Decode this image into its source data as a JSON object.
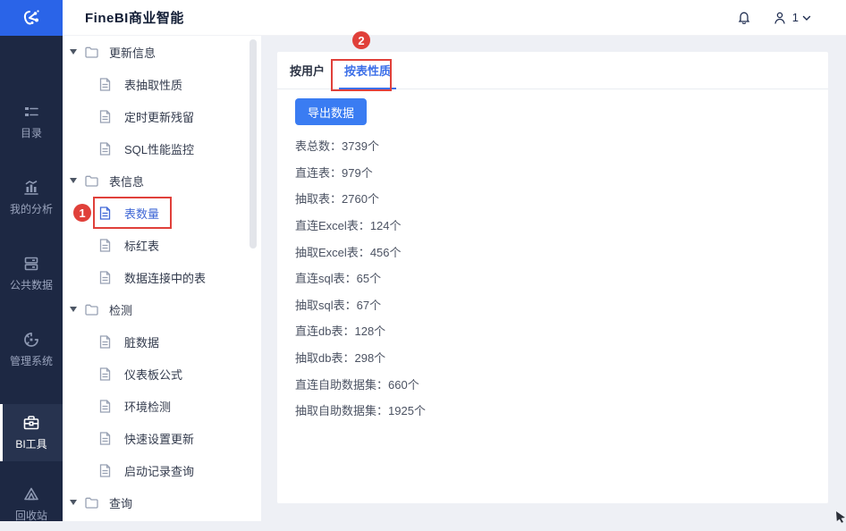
{
  "header": {
    "title": "FineBI商业智能",
    "account_count": "1"
  },
  "sidebar": {
    "items": [
      {
        "label": "目录",
        "icon": "catalog-icon",
        "active": false
      },
      {
        "label": "我的分析",
        "icon": "my-analysis-icon",
        "active": false
      },
      {
        "label": "公共数据",
        "icon": "public-data-icon",
        "active": false
      },
      {
        "label": "管理系统",
        "icon": "admin-system-icon",
        "active": false
      },
      {
        "label": "BI工具",
        "icon": "bi-tools-icon",
        "active": true
      },
      {
        "label": "回收站",
        "icon": "recycle-bin-icon",
        "active": false
      }
    ]
  },
  "tree": {
    "items": [
      {
        "type": "folder",
        "label": "更新信息",
        "expanded": true
      },
      {
        "type": "doc",
        "label": "表抽取性质"
      },
      {
        "type": "doc",
        "label": "定时更新残留"
      },
      {
        "type": "doc",
        "label": "SQL性能监控"
      },
      {
        "type": "folder",
        "label": "表信息",
        "expanded": true
      },
      {
        "type": "doc",
        "label": "表数量",
        "selected": true
      },
      {
        "type": "doc",
        "label": "标红表"
      },
      {
        "type": "doc",
        "label": "数据连接中的表"
      },
      {
        "type": "folder",
        "label": "检测",
        "expanded": true
      },
      {
        "type": "doc",
        "label": "脏数据"
      },
      {
        "type": "doc",
        "label": "仪表板公式"
      },
      {
        "type": "doc",
        "label": "环境检测"
      },
      {
        "type": "doc",
        "label": "快速设置更新"
      },
      {
        "type": "doc",
        "label": "启动记录查询"
      },
      {
        "type": "folder",
        "label": "查询",
        "expanded": true
      }
    ]
  },
  "main": {
    "tabs": [
      {
        "label": "按用户",
        "active": false
      },
      {
        "label": "按表性质",
        "active": true
      }
    ],
    "export_button": "导出数据",
    "colon": "：",
    "stats": [
      {
        "label": "表总数",
        "value": "3739个"
      },
      {
        "label": "直连表",
        "value": "979个"
      },
      {
        "label": "抽取表",
        "value": "2760个"
      },
      {
        "label": "直连Excel表",
        "value": "124个"
      },
      {
        "label": "抽取Excel表",
        "value": "456个"
      },
      {
        "label": "直连sql表",
        "value": "65个"
      },
      {
        "label": "抽取sql表",
        "value": "67个"
      },
      {
        "label": "直连db表",
        "value": "128个"
      },
      {
        "label": "抽取db表",
        "value": "298个"
      },
      {
        "label": "直连自助数据集",
        "value": "660个"
      },
      {
        "label": "抽取自助数据集",
        "value": "1925个"
      }
    ]
  },
  "annotations": {
    "step1": "1",
    "step2": "2",
    "color": "#e0403a"
  },
  "colors": {
    "logo_blue": "#2a64e8",
    "accent_blue": "#3a7cf2",
    "active_tab_blue": "#3c6fe8",
    "selected_tree_blue": "#4168d6",
    "sidebar_bg": "#1d2843",
    "sidebar_active_bg": "#27334f",
    "main_bg": "#eef0f5",
    "annotation_red": "#e0403a"
  }
}
